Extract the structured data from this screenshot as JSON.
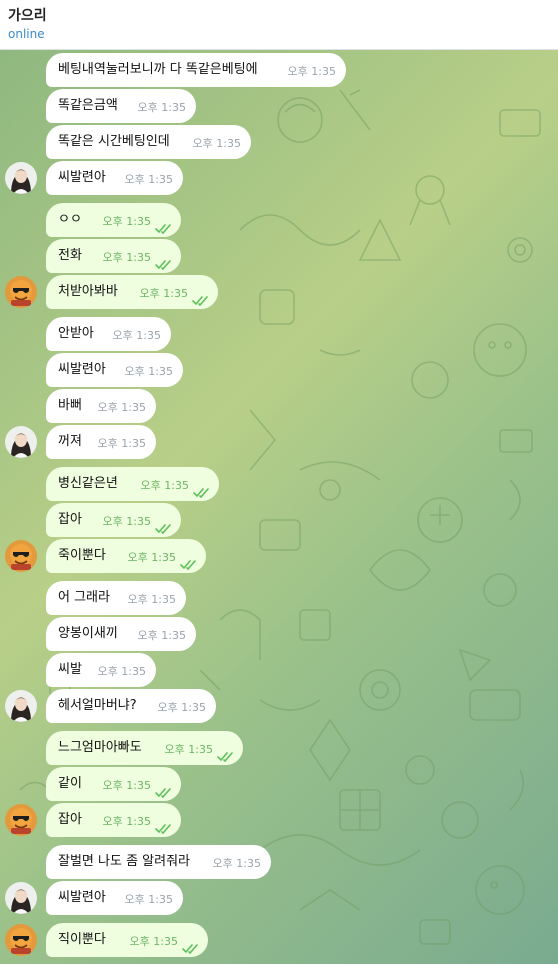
{
  "header": {
    "contact_name": "가으리",
    "status": "online"
  },
  "avatars": {
    "girl": "girl-avatar",
    "emoji": "sunglasses-emoji-avatar"
  },
  "messages": [
    {
      "text": "베팅내역눌러보니까 다 똑같은베팅에",
      "time": "오후 1:35",
      "dir": "in"
    },
    {
      "text": "똑같은금액",
      "time": "오후 1:35",
      "dir": "in"
    },
    {
      "text": "똑같은 시간베팅인데",
      "time": "오후 1:35",
      "dir": "in"
    },
    {
      "text": "씨발련아",
      "time": "오후 1:35",
      "dir": "in"
    },
    {
      "text": "ㅇㅇ",
      "time": "오후 1:35",
      "dir": "out"
    },
    {
      "text": "전화",
      "time": "오후 1:35",
      "dir": "out"
    },
    {
      "text": "처받아봐바",
      "time": "오후 1:35",
      "dir": "out"
    },
    {
      "text": "안받아",
      "time": "오후 1:35",
      "dir": "in"
    },
    {
      "text": "씨발련아",
      "time": "오후 1:35",
      "dir": "in"
    },
    {
      "text": "바뻐",
      "time": "오후 1:35",
      "dir": "in"
    },
    {
      "text": "꺼져",
      "time": "오후 1:35",
      "dir": "in"
    },
    {
      "text": "병신같은년",
      "time": "오후 1:35",
      "dir": "out"
    },
    {
      "text": "잡아",
      "time": "오후 1:35",
      "dir": "out"
    },
    {
      "text": "죽이뿐다",
      "time": "오후 1:35",
      "dir": "out"
    },
    {
      "text": "어 그래라",
      "time": "오후 1:35",
      "dir": "in"
    },
    {
      "text": "양봉이새끼",
      "time": "오후 1:35",
      "dir": "in"
    },
    {
      "text": "씨발",
      "time": "오후 1:35",
      "dir": "in"
    },
    {
      "text": "헤서얼마버냐?",
      "time": "오후 1:35",
      "dir": "in"
    },
    {
      "text": "느그엄마아빠도",
      "time": "오후 1:35",
      "dir": "out"
    },
    {
      "text": "같이",
      "time": "오후 1:35",
      "dir": "out"
    },
    {
      "text": "잡아",
      "time": "오후 1:35",
      "dir": "out"
    },
    {
      "text": "잘벌면 나도 좀 알려줘라",
      "time": "오후 1:35",
      "dir": "in"
    },
    {
      "text": "씨발련아",
      "time": "오후 1:35",
      "dir": "in"
    },
    {
      "text": "직이뿐다",
      "time": "오후 1:35",
      "dir": "out"
    }
  ],
  "colors": {
    "incoming_bubble": "#ffffff",
    "outgoing_bubble": "#eefedf",
    "status_link": "#3a8bc9",
    "read_ticks": "#5ec05a"
  }
}
